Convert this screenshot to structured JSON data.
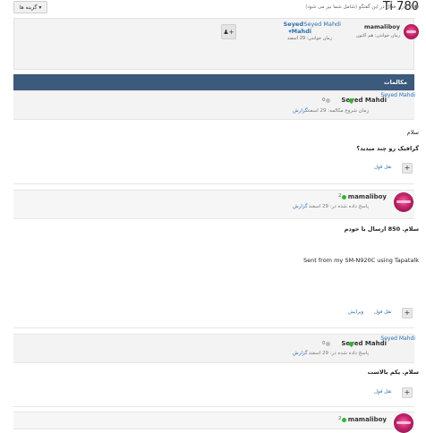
{
  "toolbar": {
    "options_label": "گزینه ها",
    "options_arrow": "▾"
  },
  "thread": {
    "title": "Ti 780"
  },
  "participants": {
    "online_note": "2 کاربر فعال در این گفتگو (شامل شما نیز می شود)",
    "user1": {
      "name": "mamaliboy",
      "status": "زمان خواندن: هم اکنون"
    },
    "user2": {
      "name_a": "Seyed Mahdi",
      "name_b": "Seyed",
      "name_c": "Mahdi",
      "status": "زمان خواندن: 29 اسفند"
    },
    "add_user_symbol": "+"
  },
  "section": {
    "title": "مکالمات"
  },
  "messages": [
    {
      "author_label": "Seyed Mahdi",
      "author_display": "Seyed Mahdi",
      "count": "0",
      "meta": "زمان شروع مکالمه: 29 اسفند",
      "report": "گزارش",
      "lines": [
        "سلام",
        "گرافیک رو چند میدید؟"
      ],
      "actions": [
        "نقل قول"
      ]
    },
    {
      "author_display": "mamaliboy",
      "count": "2",
      "meta": "پاسخ داده شده در: 29 اسفند",
      "report": "گزارش",
      "lines": [
        "سلام. 850 ارسال با خودم",
        "Sent from my SM-N920C using Tapatalk"
      ],
      "actions": [
        "نقل قول",
        "ویرایش"
      ]
    },
    {
      "author_label": "Seyed Mahdi",
      "author_display": "Seyed Mahdi",
      "count": "0",
      "meta": "پاسخ داده شده در: 29 اسفند",
      "report": "گزارش",
      "lines": [
        "سلام. یکم بالاست"
      ],
      "actions": [
        "نقل قول"
      ]
    },
    {
      "author_display": "mamaliboy",
      "count": "2"
    }
  ],
  "colors": {
    "bar": "#3b5a7c",
    "link": "#2a6fb0",
    "online": "#2eb82e"
  }
}
